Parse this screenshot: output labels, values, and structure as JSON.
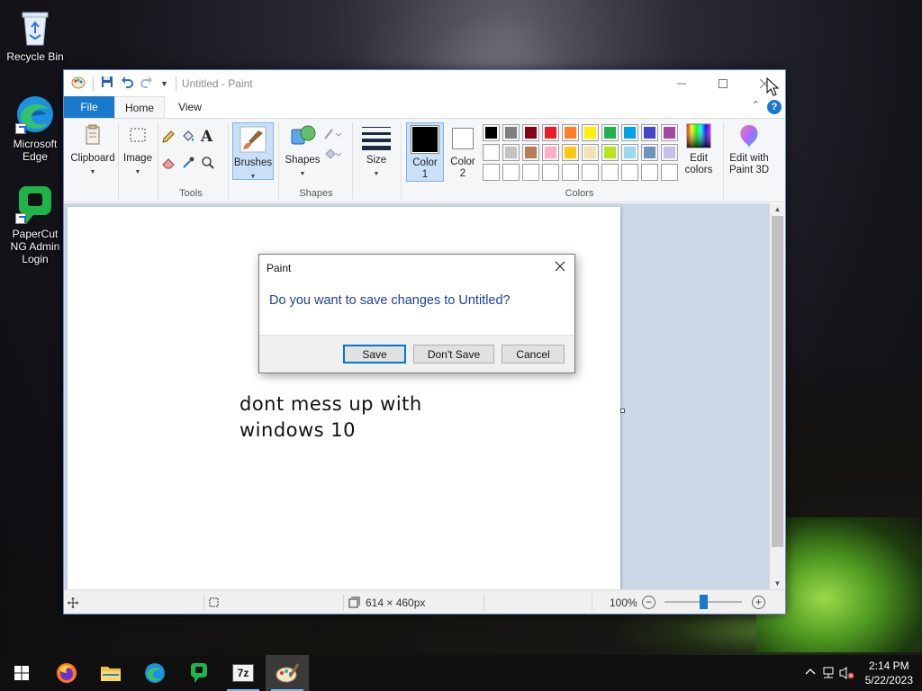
{
  "desktop": {
    "icons": [
      {
        "label": "Recycle Bin"
      },
      {
        "label": "Microsoft Edge"
      },
      {
        "label": "PaperCut NG Admin Login"
      }
    ]
  },
  "paint": {
    "title": "Untitled - Paint",
    "tabs": {
      "file": "File",
      "home": "Home",
      "view": "View"
    },
    "help_label": "?",
    "ribbon": {
      "clipboard": "Clipboard",
      "image": "Image",
      "tools_group": "Tools",
      "brushes": "Brushes",
      "shapes": "Shapes",
      "shapes_group": "Shapes",
      "size": "Size",
      "color1": "Color\n1",
      "color1_line1": "Color",
      "color1_line2": "1",
      "color2_line1": "Color",
      "color2_line2": "2",
      "edit_colors_line1": "Edit",
      "edit_colors_line2": "colors",
      "paint3d_line1": "Edit with",
      "paint3d_line2": "Paint 3D",
      "colors_group": "Colors"
    },
    "palette": {
      "row1": [
        "#000000",
        "#7f7f7f",
        "#880015",
        "#ed1c24",
        "#ff7f27",
        "#fff200",
        "#22b14c",
        "#00a2e8",
        "#3f48cc",
        "#a349a4"
      ],
      "row2": [
        "#ffffff",
        "#c3c3c3",
        "#b97a57",
        "#ffaec9",
        "#ffc90e",
        "#efe4b0",
        "#b5e61d",
        "#99d9ea",
        "#7092be",
        "#c8bfe7"
      ],
      "color1": "#000000",
      "color2": "#ffffff",
      "accent": "#1979ca"
    },
    "canvas_text_line1": "dont mess up with",
    "canvas_text_line2": "windows 10",
    "status": {
      "dimensions": "614 × 460px",
      "zoom": "100%",
      "zoom_fraction": 0.5
    }
  },
  "dialog": {
    "title": "Paint",
    "message": "Do you want to save changes to Untitled?",
    "save": "Save",
    "dont_save": "Don't Save",
    "cancel": "Cancel"
  },
  "taskbar": {
    "time": "2:14 PM",
    "date": "5/22/2023"
  }
}
